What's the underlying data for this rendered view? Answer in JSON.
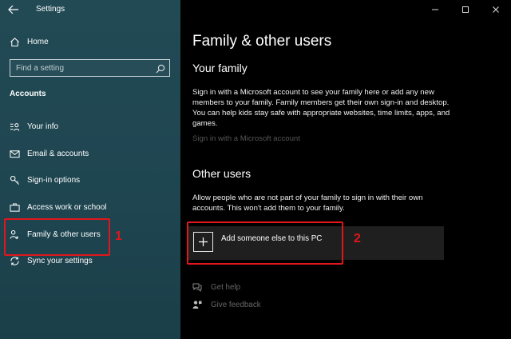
{
  "window": {
    "title": "Settings",
    "controls": [
      "minimize",
      "maximize",
      "close"
    ]
  },
  "sidebar": {
    "home_label": "Home",
    "search": {
      "placeholder": "Find a setting"
    },
    "section_label": "Accounts",
    "items": [
      {
        "label": "Your info",
        "icon": "person-card-icon"
      },
      {
        "label": "Email & accounts",
        "icon": "mail-icon"
      },
      {
        "label": "Sign-in options",
        "icon": "key-icon"
      },
      {
        "label": "Access work or school",
        "icon": "briefcase-icon"
      },
      {
        "label": "Family & other users",
        "icon": "people-icon",
        "selected": true
      },
      {
        "label": "Sync your settings",
        "icon": "sync-icon"
      }
    ]
  },
  "main": {
    "title": "Family & other users",
    "family": {
      "heading": "Your family",
      "description": "Sign in with a Microsoft account to see your family here or add any new members to your family. Family members get their own sign-in and desktop. You can help kids stay safe with appropriate websites, time limits, apps, and games.",
      "link": "Sign in with a Microsoft account"
    },
    "other_users": {
      "heading": "Other users",
      "description": "Allow people who are not part of your family to sign in with their own accounts. This won't add them to your family.",
      "add_label": "Add someone else to this PC"
    },
    "help": {
      "get_help": "Get help",
      "feedback": "Give feedback"
    }
  },
  "annotations": {
    "marker_1": "1",
    "marker_2": "2",
    "highlight_color": "#e0161c"
  },
  "colors": {
    "sidebar_bg": "#1e4550",
    "main_bg": "#000000",
    "disabled_text": "#555555"
  }
}
